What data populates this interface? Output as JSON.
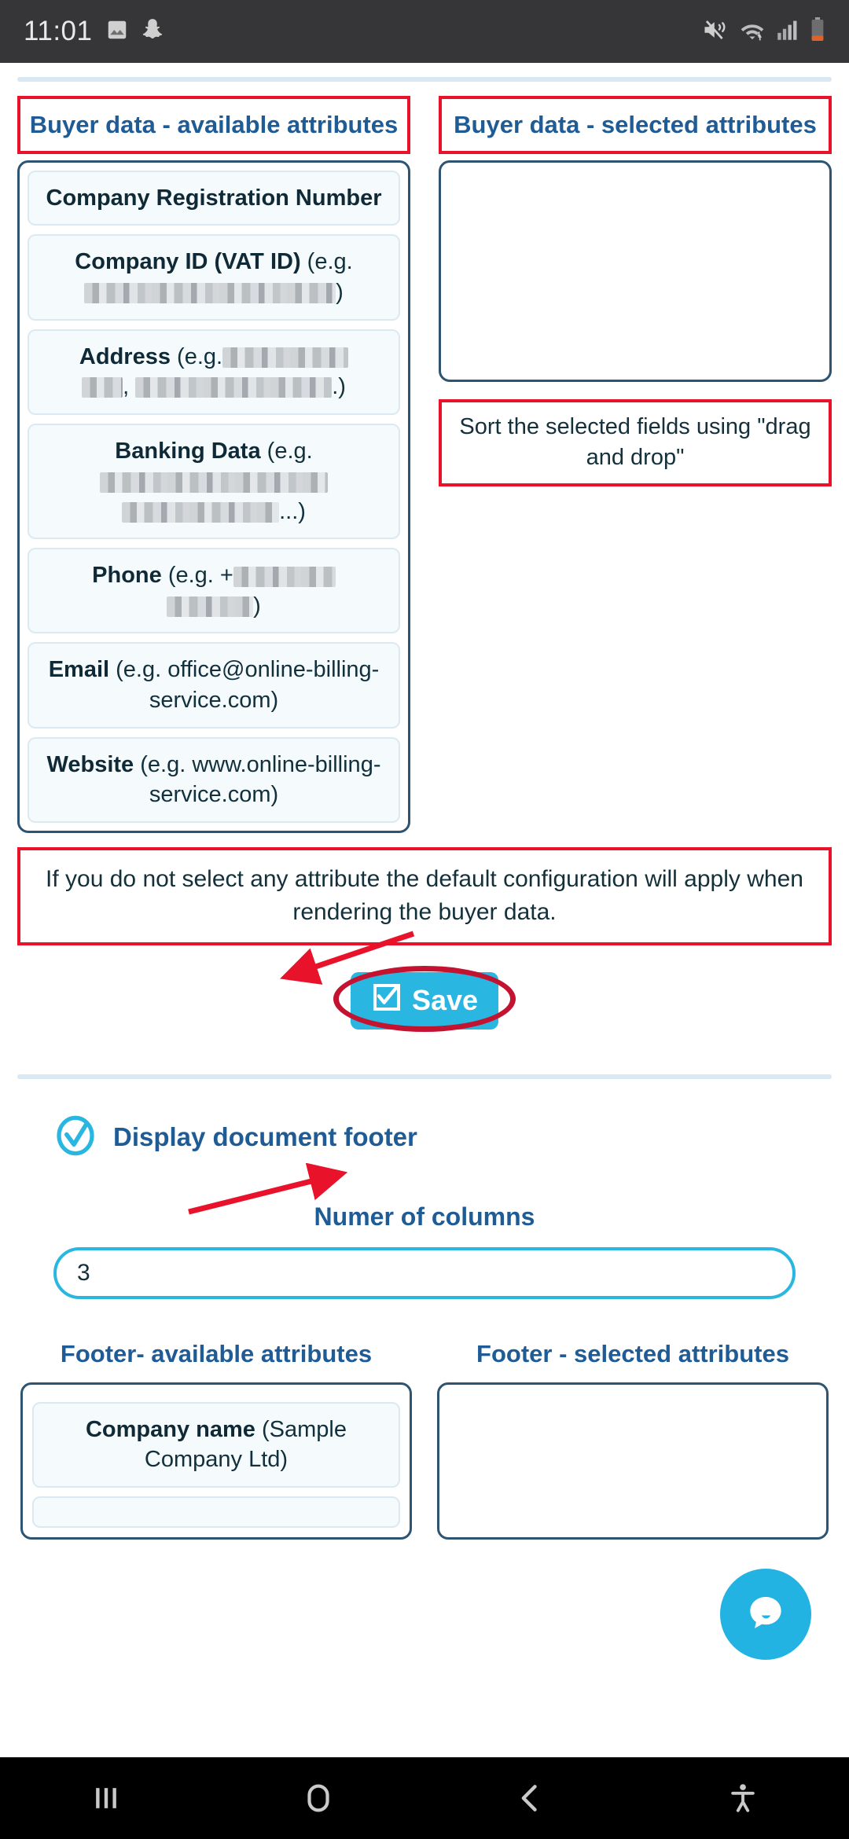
{
  "statusbar": {
    "time": "11:01",
    "icons_left": [
      "image-icon",
      "snapchat-icon"
    ],
    "icons_right": [
      "mute-icon",
      "wifi-icon",
      "signal-icon",
      "battery-icon"
    ]
  },
  "buyer_section": {
    "available_title": "Buyer data - available attributes",
    "selected_title": "Buyer data - selected attributes",
    "available_attributes": [
      {
        "label": "Company Registration Number",
        "example": "",
        "redacted": []
      },
      {
        "label": "Company ID (VAT ID)",
        "example": "(e.g.",
        "redacted": [
          320
        ]
      },
      {
        "label": "Address",
        "example": "(e.g.",
        "redacted": [
          230,
          430
        ]
      },
      {
        "label": "Banking Data",
        "example": "(e.g.",
        "redacted": [
          330,
          250
        ]
      },
      {
        "label": "Phone",
        "example": "(e.g. +",
        "redacted": [
          150,
          120
        ]
      },
      {
        "label": "Email",
        "example": "(e.g. office@online-billing-service.com)",
        "redacted": []
      },
      {
        "label": "Website",
        "example": "(e.g. www.online-billing-service.com)",
        "redacted": []
      }
    ],
    "selected_attributes": [],
    "sort_hint": "Sort the selected fields using \"drag and drop\"",
    "notice": "If you do not select any attribute the default configuration will apply when rendering the buyer data.",
    "save_label": "Save"
  },
  "footer_section": {
    "display_footer_label": "Display document footer",
    "display_footer_checked": true,
    "columns_label": "Numer of columns",
    "columns_value": "3",
    "available_title": "Footer- available attributes",
    "selected_title": "Footer - selected attributes",
    "available_attributes": [
      {
        "label": "Company name",
        "example": "(Sample Company Ltd)"
      }
    ],
    "selected_attributes": []
  },
  "chat": {
    "icon": "chat-bubble-icon"
  },
  "navbar": {
    "recents_label": "recent-apps",
    "home_label": "home",
    "back_label": "back",
    "accessibility_label": "accessibility"
  },
  "colors": {
    "heading_blue": "#1f5c96",
    "accent_cyan": "#29b6e0",
    "annotation_red": "#e8132b",
    "panel_border": "#2d5572",
    "attr_bg": "#f5fafc"
  }
}
